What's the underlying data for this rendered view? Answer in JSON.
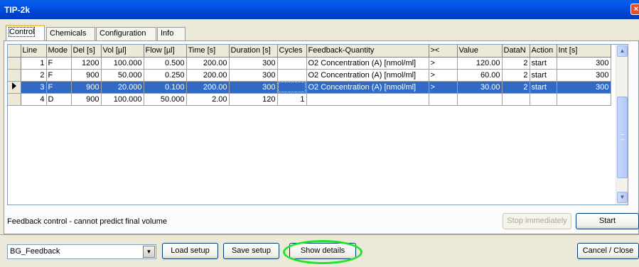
{
  "window": {
    "title": "TIP-2k",
    "close_glyph": "×"
  },
  "tabs": [
    {
      "label": "Control",
      "active": true
    },
    {
      "label": "Chemicals",
      "active": false
    },
    {
      "label": "Configuration",
      "active": false
    },
    {
      "label": "Info",
      "active": false
    }
  ],
  "table": {
    "columns": [
      "Line",
      "Mode",
      "Del [s]",
      "Vol [µl]",
      "Flow [µl]",
      "Time [s]",
      "Duration [s]",
      "Cycles",
      "Feedback-Quantity",
      "><",
      "Value",
      "DataN",
      "Action",
      "Int [s]"
    ],
    "rows": [
      {
        "line": "1",
        "mode": "F",
        "del": "1200",
        "vol": "100.000",
        "flow": "0.500",
        "time": "200.00",
        "duration": "300",
        "cycles": "",
        "feedback": "O2 Concentration (A) [nmol/ml]",
        "cmp": ">",
        "value": "120.00",
        "datan": "2",
        "action": "start",
        "int": "300"
      },
      {
        "line": "2",
        "mode": "F",
        "del": "900",
        "vol": "50.000",
        "flow": "0.250",
        "time": "200.00",
        "duration": "300",
        "cycles": "",
        "feedback": "O2 Concentration (A) [nmol/ml]",
        "cmp": ">",
        "value": "60.00",
        "datan": "2",
        "action": "start",
        "int": "300"
      },
      {
        "line": "3",
        "mode": "F",
        "del": "900",
        "vol": "20.000",
        "flow": "0.100",
        "time": "200.00",
        "duration": "300",
        "cycles": "",
        "feedback": "O2 Concentration (A) [nmol/ml]",
        "cmp": ">",
        "value": "30.00",
        "datan": "2",
        "action": "start",
        "int": "300"
      },
      {
        "line": "4",
        "mode": "D",
        "del": "900",
        "vol": "100.000",
        "flow": "50.000",
        "time": "2.00",
        "duration": "120",
        "cycles": "1",
        "feedback": "",
        "cmp": "",
        "value": "",
        "datan": "",
        "action": "",
        "int": ""
      }
    ],
    "selected_row": 3
  },
  "status": {
    "message": "Feedback control - cannot predict final volume"
  },
  "buttons": {
    "stop": "Stop immediately",
    "start": "Start",
    "load": "Load setup",
    "save": "Save setup",
    "details": "Show details",
    "cancel": "Cancel / Close"
  },
  "setup_select": {
    "value": "BG_Feedback"
  },
  "icons": {
    "scroll_up": "▲",
    "scroll_down": "▼",
    "dropdown": "▼"
  },
  "colors": {
    "selection": "#316ac5",
    "highlight_ring": "#22e22e",
    "titlebar": "#0054e3"
  }
}
